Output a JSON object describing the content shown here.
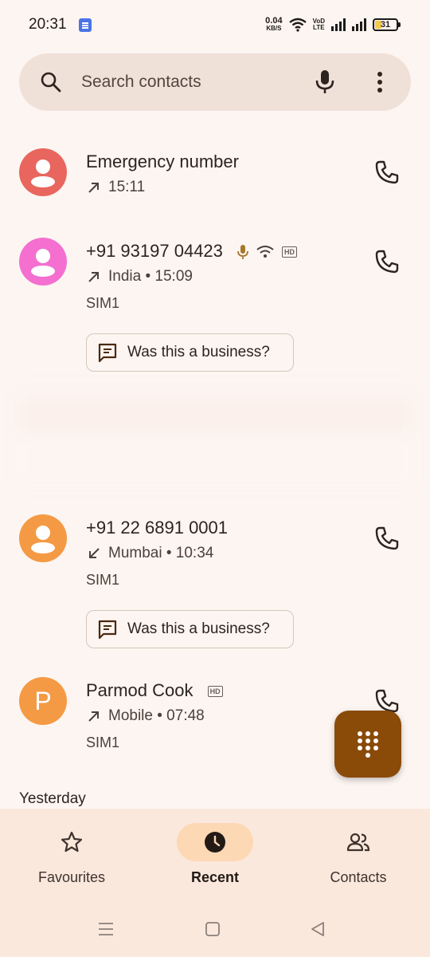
{
  "status_bar": {
    "time": "20:31",
    "net_speed_value": "0.04",
    "net_speed_unit": "KB/S",
    "volte_top": "VoD",
    "volte_bottom": "LTE",
    "battery_level": "31"
  },
  "search": {
    "placeholder": "Search contacts",
    "icons": [
      "search-icon",
      "mic-icon",
      "more-vert-icon"
    ]
  },
  "calls": [
    {
      "name": "Emergency number",
      "direction": "outgoing",
      "subtitle": "15:11",
      "avatar_color": "#e8665e"
    },
    {
      "name": "+91 93197 04423",
      "direction": "outgoing",
      "subtitle": "India • 15:09",
      "sim": "SIM1",
      "business_prompt": "Was this a business?",
      "avatar_color": "#f46fcf",
      "badges": [
        "voice-icon",
        "wifi-call-icon",
        "HD"
      ]
    },
    {
      "name": "+91 22 6891 0001",
      "direction": "incoming",
      "subtitle": "Mumbai • 10:34",
      "sim": "SIM1",
      "business_prompt": "Was this a business?",
      "avatar_color": "#f49a44"
    },
    {
      "name": "Parmod Cook",
      "direction": "outgoing",
      "subtitle": "Mobile • 07:48",
      "sim": "SIM1",
      "avatar_letter": "P",
      "avatar_color": "#f49a44",
      "badges": [
        "HD"
      ]
    }
  ],
  "section_header": "Yesterday",
  "fab": {
    "icon": "dialpad-icon",
    "color": "#8a4a08"
  },
  "bottom_nav": [
    {
      "label": "Favourites",
      "icon": "star-icon",
      "active": false
    },
    {
      "label": "Recent",
      "icon": "clock-icon",
      "active": true
    },
    {
      "label": "Contacts",
      "icon": "people-icon",
      "active": false
    }
  ],
  "hd_label": "HD"
}
